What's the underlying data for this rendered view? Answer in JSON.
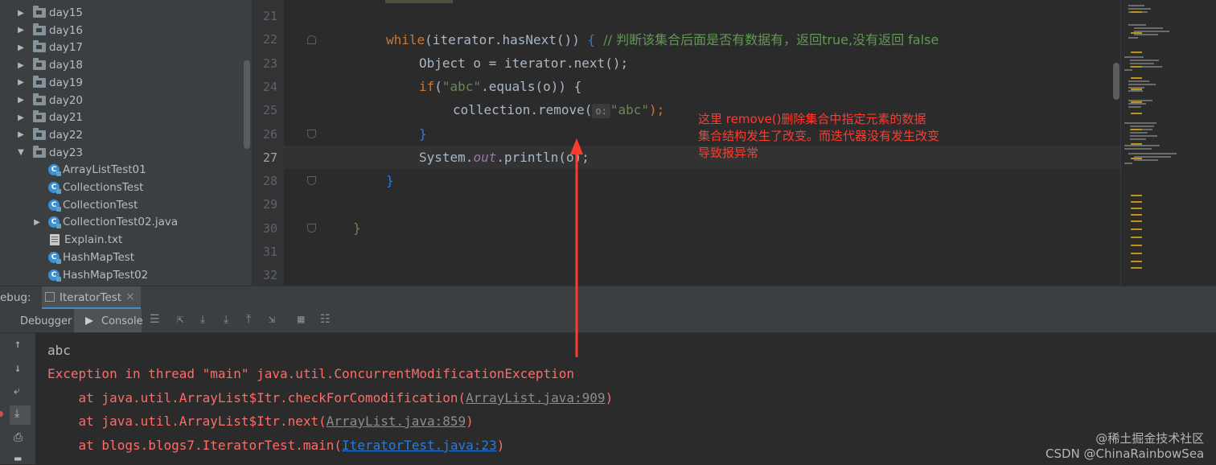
{
  "tree": {
    "items": [
      {
        "label": "day15",
        "kind": "folder",
        "expanded": false
      },
      {
        "label": "day16",
        "kind": "folder",
        "expanded": false
      },
      {
        "label": "day17",
        "kind": "folder",
        "expanded": false
      },
      {
        "label": "day18",
        "kind": "folder",
        "expanded": false
      },
      {
        "label": "day19",
        "kind": "folder",
        "expanded": false
      },
      {
        "label": "day20",
        "kind": "folder",
        "expanded": false
      },
      {
        "label": "day21",
        "kind": "folder",
        "expanded": false
      },
      {
        "label": "day22",
        "kind": "folder",
        "expanded": false
      },
      {
        "label": "day23",
        "kind": "folder",
        "expanded": true
      },
      {
        "label": "ArrayListTest01",
        "kind": "class"
      },
      {
        "label": "CollectionsTest",
        "kind": "class"
      },
      {
        "label": "CollectionTest",
        "kind": "class"
      },
      {
        "label": "CollectionTest02.java",
        "kind": "class-collapsed"
      },
      {
        "label": "Explain.txt",
        "kind": "text"
      },
      {
        "label": "HashMapTest",
        "kind": "class"
      },
      {
        "label": "HashMapTest02",
        "kind": "class"
      }
    ]
  },
  "editor": {
    "line_numbers": [
      "21",
      "22",
      "23",
      "24",
      "25",
      "26",
      "27",
      "28",
      "29",
      "30",
      "31",
      "32"
    ],
    "current_line": "27",
    "lines": {
      "l22_kw": "while",
      "l22_code": "(iterator.hasNext()) ",
      "l22_brace": "{",
      "l22_comment": "  // 判断该集合后面是否有数据有，返回true,没有返回 false",
      "l23": "Object o = iterator.next();",
      "l24_kw": "if",
      "l24_a": "(",
      "l24_str": "\"abc\"",
      "l24_b": ".equals(o)) {",
      "l25_a": "collection.remove(",
      "l25_hint": "o:",
      "l25_str": "\"abc\"",
      "l25_b": ");",
      "l26": "}",
      "l27_a": "System.",
      "l27_fld": "out",
      "l27_b": ".println(o);",
      "l28": "}",
      "l30": "}"
    },
    "annotation": [
      "这里 remove()删除集合中指定元素的数据",
      "集合结构发生了改变。而迭代器没有发生改变",
      "导致报异常"
    ],
    "annotation_color": "#ff3b30"
  },
  "debug": {
    "label": "ebug:",
    "session_tab": "IteratorTest",
    "close": "×",
    "tabs": {
      "debugger": "Debugger",
      "console": "Console"
    }
  },
  "console": {
    "line1": "abc",
    "line2": "Exception in thread \"main\" java.util.ConcurrentModificationException",
    "line3_a": "    at java.util.ArrayList$Itr.checkForComodification(",
    "line3_link": "ArrayList.java:909",
    "line3_b": ")",
    "line4_a": "    at java.util.ArrayList$Itr.next(",
    "line4_link": "ArrayList.java:859",
    "line4_b": ")",
    "line5_a": "    at blogs.blogs7.IteratorTest.main(",
    "line5_link": "IteratorTest.java:23",
    "line5_b": ")"
  },
  "watermark": {
    "line1": "@稀土掘金技术社区",
    "line2": "CSDN @ChinaRainbowSea"
  }
}
